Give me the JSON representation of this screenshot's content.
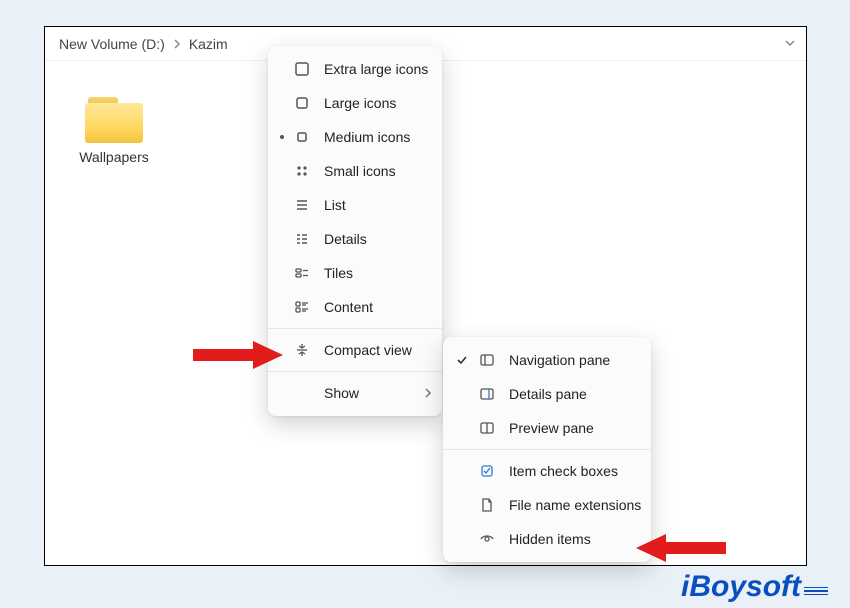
{
  "breadcrumb": {
    "parent": "New Volume (D:)",
    "current": "Kazim"
  },
  "folder": {
    "name": "Wallpapers"
  },
  "viewMenu": {
    "items": [
      {
        "label": "Extra large icons",
        "icon": "square-large",
        "selected": false
      },
      {
        "label": "Large icons",
        "icon": "square-large",
        "selected": false
      },
      {
        "label": "Medium icons",
        "icon": "square-medium",
        "selected": true
      },
      {
        "label": "Small icons",
        "icon": "grid-4",
        "selected": false
      },
      {
        "label": "List",
        "icon": "list-lines",
        "selected": false
      },
      {
        "label": "Details",
        "icon": "details-lines",
        "selected": false
      },
      {
        "label": "Tiles",
        "icon": "tiles",
        "selected": false
      },
      {
        "label": "Content",
        "icon": "content-lines",
        "selected": false
      }
    ],
    "compact": {
      "label": "Compact view",
      "icon": "compact"
    },
    "show": {
      "label": "Show",
      "hasSubmenu": true
    }
  },
  "showSubmenu": {
    "items": [
      {
        "label": "Navigation pane",
        "icon": "pane-left",
        "checked": true
      },
      {
        "label": "Details pane",
        "icon": "pane-right",
        "checked": false
      },
      {
        "label": "Preview pane",
        "icon": "pane-split",
        "checked": false
      }
    ],
    "items2": [
      {
        "label": "Item check boxes",
        "icon": "checkbox",
        "checked": false
      },
      {
        "label": "File name extensions",
        "icon": "file",
        "checked": false
      },
      {
        "label": "Hidden items",
        "icon": "eye",
        "checked": false
      }
    ]
  },
  "brand": "iBoysoft"
}
